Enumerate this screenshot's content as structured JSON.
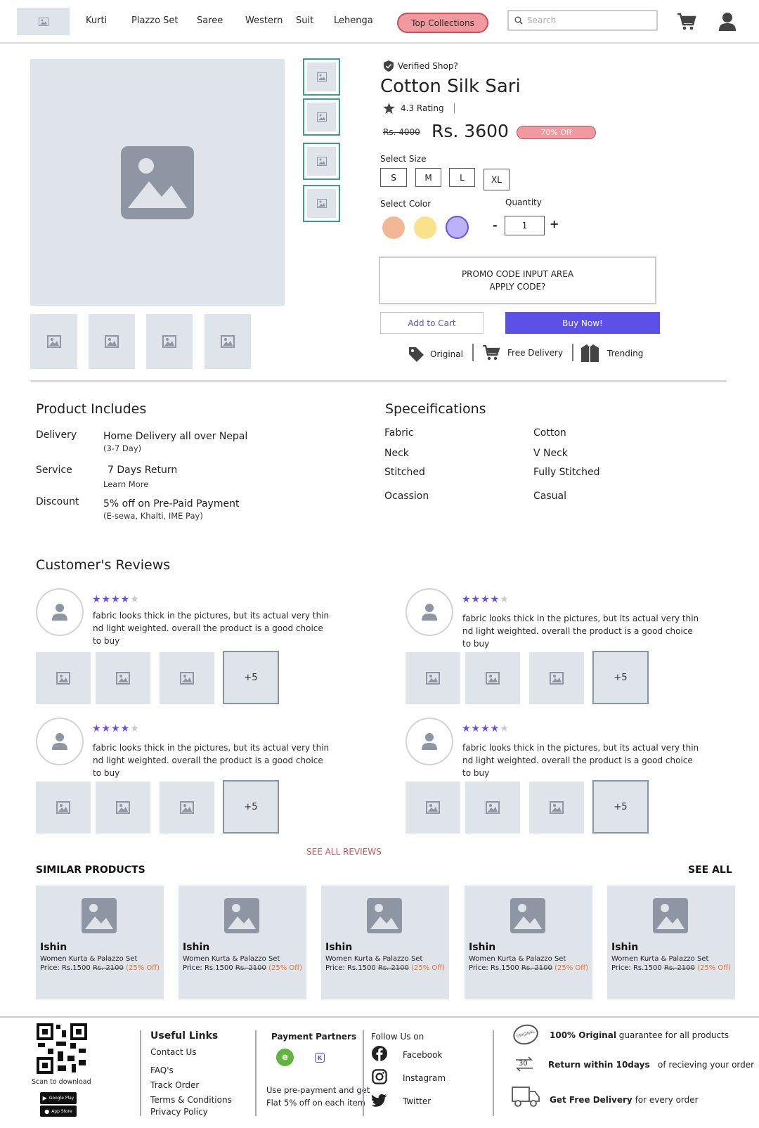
{
  "nav": {
    "links": [
      "Kurti",
      "Plazzo Set",
      "Saree",
      "Western",
      "Suit",
      "Lehenga"
    ],
    "top_collections": "Top Collections",
    "search_placeholder": "Search"
  },
  "product": {
    "verified": "Verified Shop?",
    "title": "Cotton Silk Sari",
    "rating": "4.3 Rating",
    "old_price": "Rs. 4000",
    "price": "Rs. 3600",
    "discount": "70% Off",
    "select_size": "Select Size",
    "sizes": [
      "S",
      "M",
      "L",
      "XL"
    ],
    "select_color": "Select Color",
    "colors": [
      "#f2b896",
      "#fae28a",
      "#b9b2f6"
    ],
    "quantity_label": "Quantity",
    "quantity_value": "1",
    "minus": "-",
    "plus": "+",
    "promo_line1": "PROMO CODE INPUT AREA",
    "promo_line2": "APPLY CODE?",
    "add_to_cart": "Add to Cart",
    "buy_now": "Buy Now!",
    "badges": [
      "Original",
      "Free Delivery",
      "Trending"
    ]
  },
  "includes": {
    "heading": "Product Includes",
    "items": [
      {
        "label": "Delivery",
        "value": "Home Delivery all over Nepal",
        "sub": "(3-7 Day)"
      },
      {
        "label": "Service",
        "value": "7 Days Return",
        "sub": "Learn More"
      },
      {
        "label": "Discount",
        "value": "5% off on Pre-Paid Payment",
        "sub": "(E-sewa, Khalti, IME Pay)"
      }
    ]
  },
  "specs": {
    "heading": "Speceifications",
    "items": [
      {
        "label": "Fabric",
        "value": "Cotton"
      },
      {
        "label": "Neck",
        "value": "V Neck"
      },
      {
        "label": "Stitched",
        "value": "Fully Stitched"
      },
      {
        "label": "Ocassion",
        "value": "Casual"
      }
    ]
  },
  "reviews": {
    "heading": "Customer's Reviews",
    "text": "fabric looks thick in the pictures, but its actual very thin nd light weighted. overall the product is a good choice to buy",
    "more": "+5",
    "rating_stars": 4,
    "see_all": "SEE ALL REVIEWS"
  },
  "similar": {
    "heading": "SIMILAR PRODUCTS",
    "see_all": "SEE ALL",
    "brand": "Ishin",
    "name": "Women Kurta & Palazzo Set",
    "price": "Price: Rs.1500",
    "old_price": "Rs. 2100",
    "off": "(25% Off)"
  },
  "footer": {
    "scan": "Scan to download",
    "google_play": "Google Play",
    "app_store": "App Store",
    "useful_heading": "Useful Links",
    "links": [
      "Contact Us",
      "FAQ's",
      "Track Order",
      "Terms & Conditions",
      "Privacy Policy"
    ],
    "payment_heading": "Payment Partners",
    "payment_text": "Use pre-payment and get Flat 5% off on each item",
    "follow_heading": "Follow Us on",
    "social": [
      "Facebook",
      "Instagram",
      "Twitter"
    ],
    "g1_bold": "100% Original",
    "g1_rest": "guarantee for all products",
    "g2_bold": "Return within 10days",
    "g2_rest": "of recieving your order",
    "g3_bold": "Get Free Delivery",
    "g3_rest": "for every order",
    "return_days": "30",
    "original_stamp": "ORIGINAL"
  }
}
